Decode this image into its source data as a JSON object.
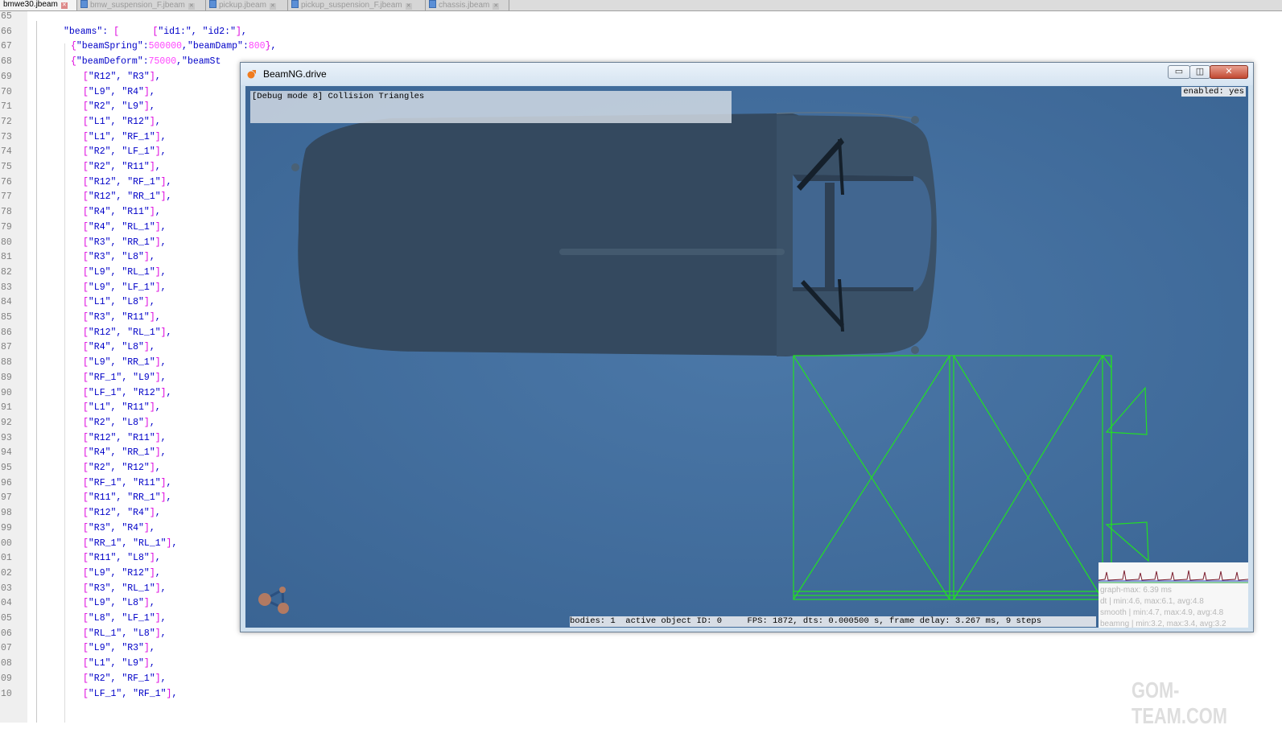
{
  "editor": {
    "tabs": [
      {
        "label": "bmwe30.jbeam",
        "active": true
      },
      {
        "label": "bmw_suspension_F.jbeam",
        "active": false
      },
      {
        "label": "pickup.jbeam",
        "active": false
      },
      {
        "label": "pickup_suspension_F.jbeam",
        "active": false
      },
      {
        "label": "chassis.jbeam",
        "active": false
      }
    ],
    "lines": [
      {
        "num": "65",
        "text": ""
      },
      {
        "num": "66",
        "text": "\"beams\": [      [\"id1:\", \"id2:\"],"
      },
      {
        "num": "67",
        "text": "{\"beamSpring\":500000,\"beamDamp\":800},"
      },
      {
        "num": "68",
        "text": "{\"beamDeform\":75000,\"beamSt"
      },
      {
        "num": "69",
        "text": "[\"R12\", \"R3\"],"
      },
      {
        "num": "70",
        "text": "[\"L9\", \"R4\"],"
      },
      {
        "num": "71",
        "text": "[\"R2\", \"L9\"],"
      },
      {
        "num": "72",
        "text": "[\"L1\", \"R12\"],"
      },
      {
        "num": "73",
        "text": "[\"L1\", \"RF_1\"],"
      },
      {
        "num": "74",
        "text": "[\"R2\", \"LF_1\"],"
      },
      {
        "num": "75",
        "text": "[\"R2\", \"R11\"],"
      },
      {
        "num": "76",
        "text": "[\"R12\", \"RF_1\"],"
      },
      {
        "num": "77",
        "text": "[\"R12\", \"RR_1\"],"
      },
      {
        "num": "78",
        "text": "[\"R4\", \"R11\"],"
      },
      {
        "num": "79",
        "text": "[\"R4\", \"RL_1\"],"
      },
      {
        "num": "80",
        "text": "[\"R3\", \"RR_1\"],"
      },
      {
        "num": "81",
        "text": "[\"R3\", \"L8\"],"
      },
      {
        "num": "82",
        "text": "[\"L9\", \"RL_1\"],"
      },
      {
        "num": "83",
        "text": "[\"L9\", \"LF_1\"],"
      },
      {
        "num": "84",
        "text": "[\"L1\", \"L8\"],"
      },
      {
        "num": "85",
        "text": "[\"R3\", \"R11\"],"
      },
      {
        "num": "86",
        "text": "[\"R12\", \"RL_1\"],"
      },
      {
        "num": "87",
        "text": "[\"R4\", \"L8\"],"
      },
      {
        "num": "88",
        "text": "[\"L9\", \"RR_1\"],"
      },
      {
        "num": "89",
        "text": "[\"RF_1\", \"L9\"],"
      },
      {
        "num": "90",
        "text": "[\"LF_1\", \"R12\"],"
      },
      {
        "num": "91",
        "text": "[\"L1\", \"R11\"],"
      },
      {
        "num": "92",
        "text": "[\"R2\", \"L8\"],"
      },
      {
        "num": "93",
        "text": "[\"R12\", \"R11\"],"
      },
      {
        "num": "94",
        "text": "[\"R4\", \"RR_1\"],"
      },
      {
        "num": "95",
        "text": "[\"R2\", \"R12\"],"
      },
      {
        "num": "96",
        "text": "[\"RF_1\", \"R11\"],"
      },
      {
        "num": "97",
        "text": "[\"R11\", \"RR_1\"],"
      },
      {
        "num": "98",
        "text": "[\"R12\", \"R4\"],"
      },
      {
        "num": "99",
        "text": "[\"R3\", \"R4\"],"
      },
      {
        "num": "00",
        "text": "[\"RR_1\", \"RL_1\"],"
      },
      {
        "num": "01",
        "text": "[\"R11\", \"L8\"],"
      },
      {
        "num": "02",
        "text": "[\"L9\", \"R12\"],"
      },
      {
        "num": "03",
        "text": "[\"R3\", \"RL_1\"],"
      },
      {
        "num": "04",
        "text": "[\"L9\", \"L8\"],"
      },
      {
        "num": "05",
        "text": "[\"L8\", \"LF_1\"],"
      },
      {
        "num": "06",
        "text": "[\"RL_1\", \"L8\"],"
      },
      {
        "num": "07",
        "text": "[\"L9\", \"R3\"],"
      },
      {
        "num": "08",
        "text": "[\"L1\", \"L9\"],"
      },
      {
        "num": "09",
        "text": "[\"R2\", \"RF_1\"],"
      },
      {
        "num": "10",
        "text": "[\"LF_1\", \"RF_1\"],"
      }
    ]
  },
  "bng": {
    "title": "BeamNG.drive",
    "buttons": {
      "minimize": "▭",
      "maximize": "◫",
      "close": "✕"
    },
    "debug_mode": "[Debug mode 8] Collision Triangles",
    "enabled": "enabled: yes",
    "status": "bodies: 1  active object ID: 0     FPS: 1872, dts: 0.000500 s, frame delay: 3.267 ms, 9 steps",
    "perf": {
      "graph_max": "graph-max: 6.39 ms",
      "dt": "dt    | min:4.6, max:6.1, avg:4.8",
      "smooth": "smooth | min:4.7, max:4.9, avg:4.8",
      "beamng": "beamng | min:3.2, max:3.4, avg:3.2"
    },
    "colors": {
      "sky": "#3f6a98",
      "car_body": "#34495f",
      "wireframe": "#22e022",
      "logo": "#f07b1e"
    }
  },
  "watermark": "GOM-TEAM.COM"
}
